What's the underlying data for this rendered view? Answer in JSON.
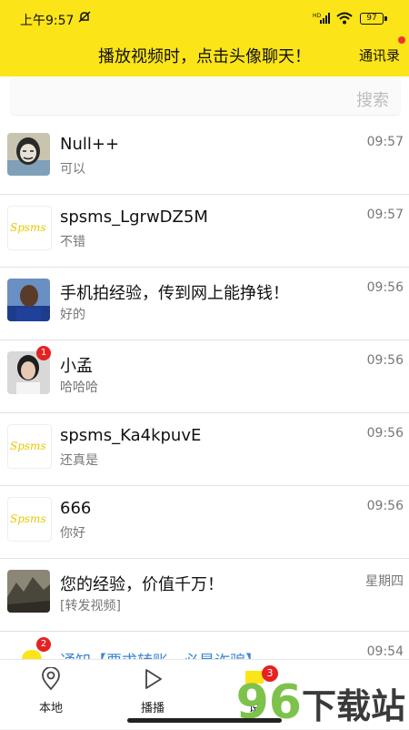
{
  "status_bar": {
    "time": "上午9:57",
    "battery": "97",
    "signal_label": "HD"
  },
  "header": {
    "banner": "播放视频时，点击头像聊天！",
    "contacts": "通讯录"
  },
  "search": {
    "placeholder": "搜索"
  },
  "conversations": [
    {
      "name": "Null++",
      "message": "可以",
      "time": "09:57",
      "avatar": "meme-face"
    },
    {
      "name": "spsms_LgrwDZ5M",
      "message": "不错",
      "time": "09:57",
      "avatar": "spsms-logo"
    },
    {
      "name": "手机拍经验，传到网上能挣钱！",
      "message": "好的",
      "time": "09:56",
      "avatar": "athlete"
    },
    {
      "name": "小孟",
      "message": "哈哈哈",
      "time": "09:56",
      "avatar": "girl",
      "badge": "1"
    },
    {
      "name": "spsms_Ka4kpuvE",
      "message": "还真是",
      "time": "09:56",
      "avatar": "spsms-logo"
    },
    {
      "name": "666",
      "message": "你好",
      "time": "09:56",
      "avatar": "spsms-logo"
    },
    {
      "name": "您的经验，价值千万！",
      "message": "[转发视频]",
      "time": "星期四",
      "avatar": "landscape"
    }
  ],
  "logo_text": "Spsms",
  "notice": {
    "name": "通知【要求转账，必是诈骗】",
    "time": "09:54",
    "badge": "2"
  },
  "tabs": [
    {
      "label": "本地",
      "icon": "location-pin-icon"
    },
    {
      "label": "播播",
      "icon": "play-icon"
    },
    {
      "label": "说",
      "icon": "chat-icon",
      "badge": "3"
    }
  ],
  "watermark": {
    "digits": "96",
    "text": "下载站"
  },
  "colors": {
    "header_bg": "#fbe418",
    "badge_red": "#e52222",
    "notice_blue": "#3a84d4"
  }
}
